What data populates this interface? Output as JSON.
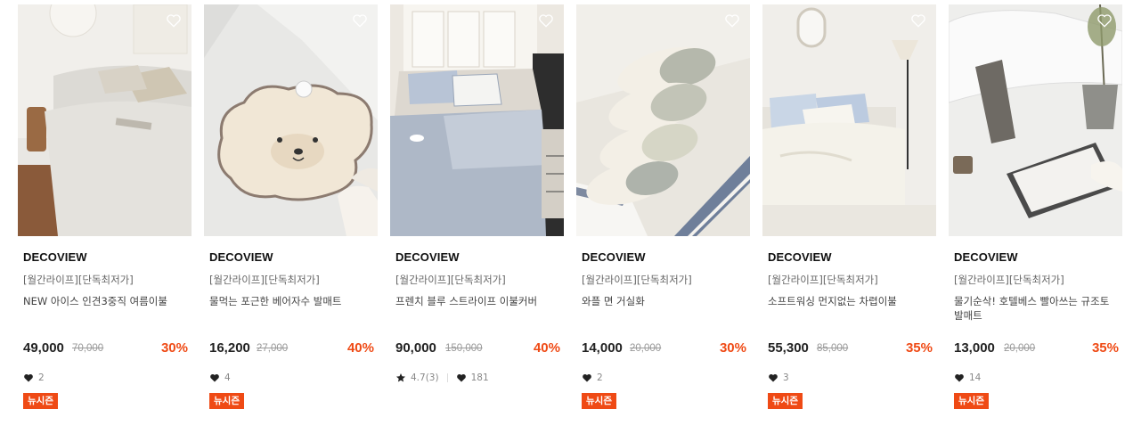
{
  "colors": {
    "accent": "#ef4a15",
    "price": "#222222",
    "muted": "#999999"
  },
  "products": [
    {
      "brand": "DECOVIEW",
      "tags": "[월간라이프][단독최저가]",
      "title": "NEW 아이스 인견3중직 여름이불",
      "price": "49,000",
      "original_price": "70,000",
      "discount": "30%",
      "likes": "2",
      "badge": "뉴시즌",
      "image_icon": "bedding-photo"
    },
    {
      "brand": "DECOVIEW",
      "tags": "[월간라이프][단독최저가]",
      "title": "물먹는 포근한 베어자수 발매트",
      "price": "16,200",
      "original_price": "27,000",
      "discount": "40%",
      "likes": "4",
      "badge": "뉴시즌",
      "image_icon": "bath-mat-photo"
    },
    {
      "brand": "DECOVIEW",
      "tags": "[월간라이프][단독최저가]",
      "title": "프렌치 블루 스트라이프 이불커버",
      "price": "90,000",
      "original_price": "150,000",
      "discount": "40%",
      "rating": "4.7(3)",
      "likes": "181",
      "badge": "",
      "image_icon": "bedding-photo"
    },
    {
      "brand": "DECOVIEW",
      "tags": "[월간라이프][단독최저가]",
      "title": "와플 면 거실화",
      "price": "14,000",
      "original_price": "20,000",
      "discount": "30%",
      "likes": "2",
      "badge": "뉴시즌",
      "image_icon": "slippers-photo"
    },
    {
      "brand": "DECOVIEW",
      "tags": "[월간라이프][단독최저가]",
      "title": "소프트워싱 먼지없는 차렵이불",
      "price": "55,300",
      "original_price": "85,000",
      "discount": "35%",
      "likes": "3",
      "badge": "뉴시즌",
      "image_icon": "bedding-photo"
    },
    {
      "brand": "DECOVIEW",
      "tags": "[월간라이프][단독최저가]",
      "title": "물기순삭! 호텔베스 빨아쓰는 규조토 발매트",
      "price": "13,000",
      "original_price": "20,000",
      "discount": "35%",
      "likes": "14",
      "badge": "뉴시즌",
      "image_icon": "bath-mat-photo"
    }
  ]
}
